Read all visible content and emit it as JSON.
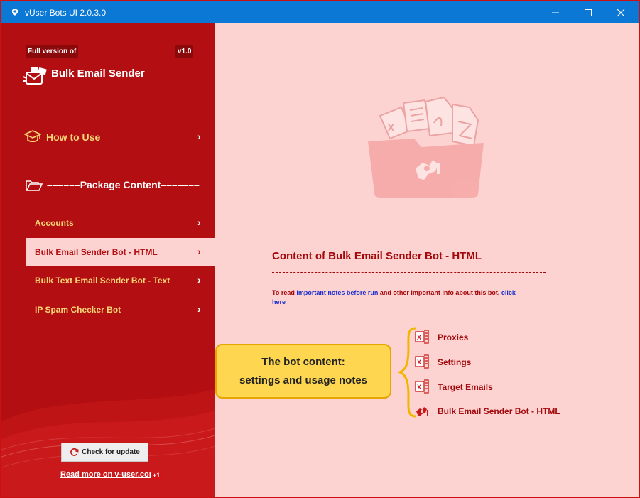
{
  "window": {
    "title": "vUser Bots UI 2.0.3.0",
    "colors": {
      "titlebar": "#0a78d4",
      "sidebar": "#b30f12",
      "main": "#fdd3d1",
      "accent": "#f7d675"
    }
  },
  "sidebar": {
    "full_version_badge": "Full version of",
    "version_badge": "v1.0",
    "app_name": "Bulk Email Sender",
    "how_to_use": "How to Use",
    "package_content": "––––––Package Content–––––––",
    "items": [
      {
        "label": "Accounts",
        "active": false
      },
      {
        "label": "Bulk Email Sender Bot - HTML",
        "active": true
      },
      {
        "label": "Bulk Text Email Sender Bot - Text",
        "active": false
      },
      {
        "label": "IP Spam Checker Bot",
        "active": false
      }
    ],
    "check_update": "Check for update",
    "read_more": "Read more on v-user.com",
    "read_more_badge": "+1"
  },
  "main": {
    "content_title": "Content of Bulk Email Sender Bot - HTML",
    "note_prefix": "To read ",
    "note_link": "Important notes before run",
    "note_middle": " and other important info about this bot, ",
    "note_click": "click here",
    "callout_line1": "The bot content:",
    "callout_line2": "settings and usage notes",
    "files": [
      {
        "label": "Proxies",
        "icon": "excel-icon"
      },
      {
        "label": "Settings",
        "icon": "excel-icon"
      },
      {
        "label": "Target Emails",
        "icon": "excel-icon"
      },
      {
        "label": "Bulk Email Sender Bot -  HTML",
        "icon": "robot-arm-icon"
      }
    ]
  }
}
